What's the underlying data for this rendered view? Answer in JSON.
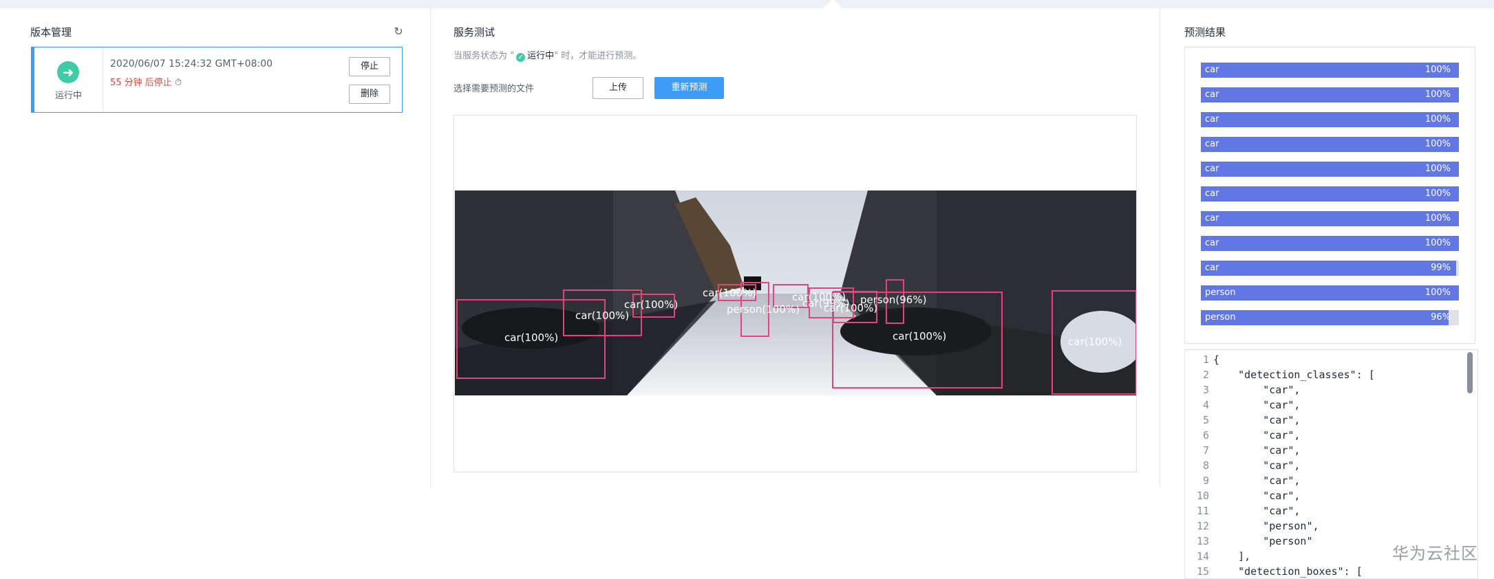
{
  "left": {
    "title": "版本管理",
    "status_label": "运行中",
    "date": "2020/06/07 15:24:32 GMT+08:00",
    "remaining": "55 分钟 后停止",
    "stop_button": "停止",
    "delete_button": "删除"
  },
  "middle": {
    "title": "服务测试",
    "hint_prefix": "当服务状态为 \"",
    "hint_status": "运行中",
    "hint_suffix": "\" 时，才能进行预测。",
    "select_file_label": "选择需要预测的文件",
    "upload_button": "上传",
    "repredict_button": "重新预测",
    "detections": [
      {
        "label": "car(100%)"
      },
      {
        "label": "car(100%)"
      },
      {
        "label": "car(100%)"
      },
      {
        "label": "car(100%)"
      },
      {
        "label": "car(100%)"
      },
      {
        "label": "car(100%)"
      },
      {
        "label": "car(100%)"
      },
      {
        "label": "car(99%)"
      },
      {
        "label": "car(100%)"
      },
      {
        "label": "person(96%)"
      },
      {
        "label": "person(100%)"
      }
    ]
  },
  "right": {
    "title": "预测结果",
    "results": [
      {
        "cls": "car",
        "pct": "100%",
        "score": 1.0
      },
      {
        "cls": "car",
        "pct": "100%",
        "score": 1.0
      },
      {
        "cls": "car",
        "pct": "100%",
        "score": 1.0
      },
      {
        "cls": "car",
        "pct": "100%",
        "score": 1.0
      },
      {
        "cls": "car",
        "pct": "100%",
        "score": 1.0
      },
      {
        "cls": "car",
        "pct": "100%",
        "score": 1.0
      },
      {
        "cls": "car",
        "pct": "100%",
        "score": 1.0
      },
      {
        "cls": "car",
        "pct": "100%",
        "score": 1.0
      },
      {
        "cls": "car",
        "pct": "99%",
        "score": 0.99
      },
      {
        "cls": "person",
        "pct": "100%",
        "score": 1.0
      },
      {
        "cls": "person",
        "pct": "96%",
        "score": 0.96
      }
    ],
    "code_lines": [
      {
        "n": "1",
        "text": "{"
      },
      {
        "n": "2",
        "text": "    \"detection_classes\": ["
      },
      {
        "n": "3",
        "text": "        \"car\","
      },
      {
        "n": "4",
        "text": "        \"car\","
      },
      {
        "n": "5",
        "text": "        \"car\","
      },
      {
        "n": "6",
        "text": "        \"car\","
      },
      {
        "n": "7",
        "text": "        \"car\","
      },
      {
        "n": "8",
        "text": "        \"car\","
      },
      {
        "n": "9",
        "text": "        \"car\","
      },
      {
        "n": "10",
        "text": "        \"car\","
      },
      {
        "n": "11",
        "text": "        \"car\","
      },
      {
        "n": "12",
        "text": "        \"person\","
      },
      {
        "n": "13",
        "text": "        \"person\""
      },
      {
        "n": "14",
        "text": "    ],"
      },
      {
        "n": "15",
        "text": "    \"detection_boxes\": ["
      }
    ]
  },
  "watermark": "华为云社区",
  "colors": {
    "accent": "#3c9cf6",
    "success": "#3dcca6",
    "danger": "#e5483d",
    "bar": "#6177e3",
    "box": "#e0457b"
  }
}
